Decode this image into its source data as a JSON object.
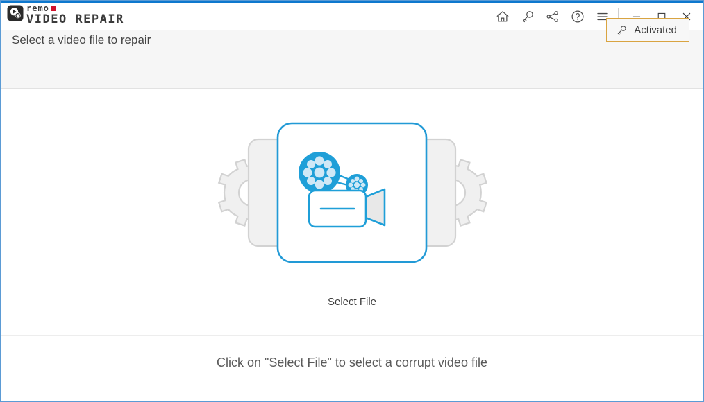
{
  "app": {
    "brand_name": "remo",
    "brand_title": "VIDEO REPAIR",
    "brand_accent_color": "#d0112b",
    "accent_bar_color": "#0e78ce"
  },
  "titlebar": {
    "icons": [
      {
        "name": "home-icon",
        "label": "Home"
      },
      {
        "name": "key-icon",
        "label": "Activate"
      },
      {
        "name": "share-icon",
        "label": "Share"
      },
      {
        "name": "help-icon",
        "label": "Help"
      },
      {
        "name": "menu-icon",
        "label": "Menu"
      }
    ],
    "window_controls": [
      {
        "name": "minimize-button",
        "label": "Minimize"
      },
      {
        "name": "maximize-button",
        "label": "Maximize"
      },
      {
        "name": "close-button",
        "label": "Close"
      }
    ]
  },
  "header": {
    "title": "Select a video file to repair",
    "activated_label": "Activated",
    "activated_border_color": "#d9a441",
    "background_color": "#f6f6f6"
  },
  "main": {
    "select_file_label": "Select File",
    "illustration": {
      "name": "video-repair-illustration",
      "box_color": "#229ad6",
      "gear_fill": "#f0f0f0",
      "gear_stroke": "#d2d2d2",
      "panel_fill": "#f1f1f1",
      "panel_stroke": "#d2d2d2",
      "camera_color": "#1f9fd8",
      "reel_fill": "#1f9fd8",
      "lens_fill": "#e8e8e8"
    }
  },
  "footer": {
    "hint": "Click on \"Select File\" to select a corrupt video file"
  }
}
